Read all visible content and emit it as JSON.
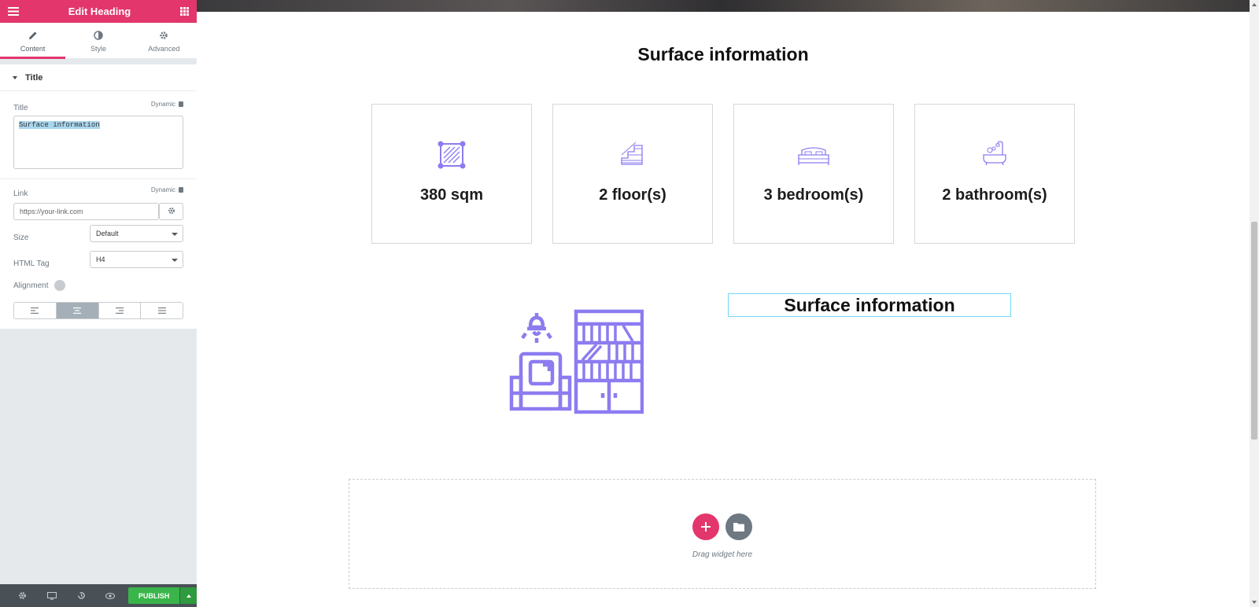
{
  "panel": {
    "header_title": "Edit Heading",
    "tabs": [
      {
        "label": "Content",
        "icon": "pencil-icon",
        "active": true
      },
      {
        "label": "Style",
        "icon": "contrast-icon",
        "active": false
      },
      {
        "label": "Advanced",
        "icon": "gear-icon",
        "active": false
      }
    ],
    "section_title": "Title",
    "title_label": "Title",
    "dynamic_label": "Dynamic",
    "title_value": "Surface information",
    "link_label": "Link",
    "link_placeholder": "https://your-link.com",
    "size_label": "Size",
    "size_value": "Default",
    "html_tag_label": "HTML Tag",
    "html_tag_value": "H4",
    "alignment_label": "Alignment",
    "alignment_selected": "center",
    "publish_label": "PUBLISH"
  },
  "canvas": {
    "section_title": "Surface information",
    "cards": [
      {
        "value": "380 sqm",
        "icon": "area-icon"
      },
      {
        "value": "2 floor(s)",
        "icon": "stairs-icon"
      },
      {
        "value": "3 bedroom(s)",
        "icon": "bed-icon"
      },
      {
        "value": "2 bathroom(s)",
        "icon": "bathtub-icon"
      }
    ],
    "edited_heading": "Surface information",
    "drop_hint": "Drag widget here"
  },
  "colors": {
    "accent": "#e2366c",
    "icon_purple": "#8c7cf0",
    "publish_green": "#39b54a",
    "selection_outline": "#71d7f7"
  }
}
